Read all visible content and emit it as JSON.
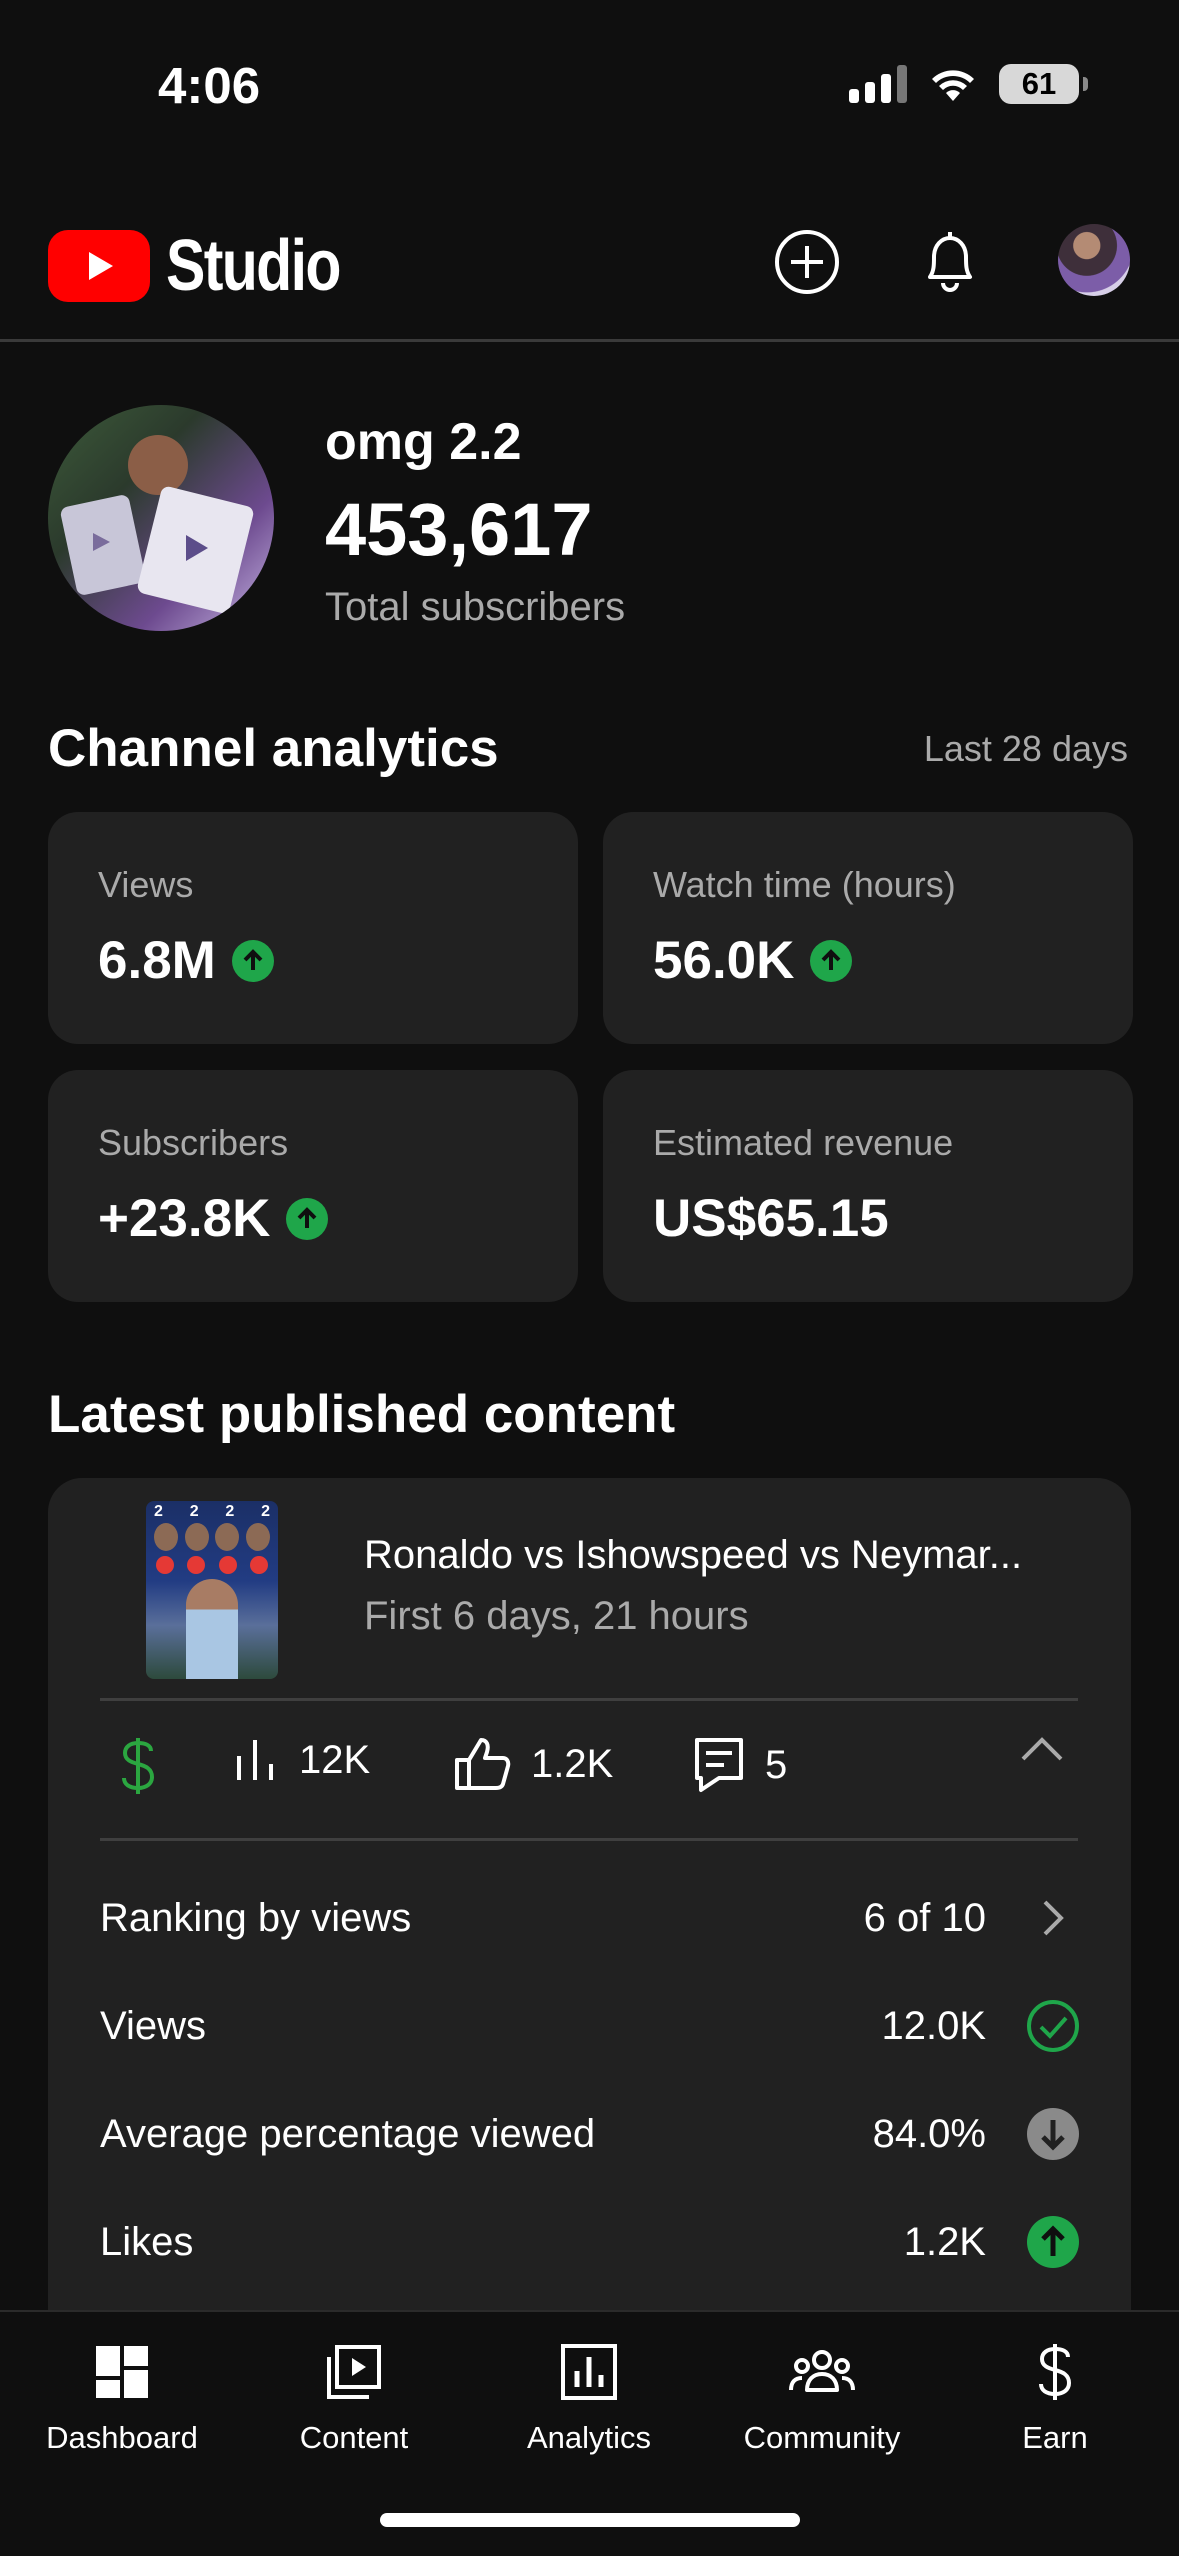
{
  "status_bar": {
    "time": "4:06",
    "battery": "61"
  },
  "header": {
    "app_name": "Studio"
  },
  "channel": {
    "name": "omg 2.2",
    "subscribers": "453,617",
    "subscribers_label": "Total subscribers"
  },
  "analytics": {
    "title": "Channel analytics",
    "period": "Last 28 days",
    "cards": [
      {
        "label": "Views",
        "value": "6.8M",
        "trend": "up"
      },
      {
        "label": "Watch time (hours)",
        "value": "56.0K",
        "trend": "up"
      },
      {
        "label": "Subscribers",
        "value": "+23.8K",
        "trend": "up"
      },
      {
        "label": "Estimated revenue",
        "value": "US$65.15"
      }
    ]
  },
  "latest": {
    "title": "Latest published content",
    "video": {
      "title": "Ronaldo vs Ishowspeed vs Neymar...",
      "age": "First 6 days, 21 hours",
      "thumbnail_numbers": [
        "2",
        "2",
        "2",
        "2"
      ]
    },
    "stats": {
      "views": "12K",
      "likes": "1.2K",
      "comments": "5"
    },
    "metrics": [
      {
        "label": "Ranking by views",
        "value": "6 of 10",
        "icon": "chevron-right-icon"
      },
      {
        "label": "Views",
        "value": "12.0K",
        "icon": "check-circle-icon"
      },
      {
        "label": "Average percentage viewed",
        "value": "84.0%",
        "icon": "arrow-down-circle-icon"
      },
      {
        "label": "Likes",
        "value": "1.2K",
        "icon": "arrow-up-circle-icon"
      }
    ]
  },
  "nav": {
    "items": [
      {
        "label": "Dashboard"
      },
      {
        "label": "Content"
      },
      {
        "label": "Analytics"
      },
      {
        "label": "Community"
      },
      {
        "label": "Earn"
      }
    ]
  },
  "colors": {
    "accent_red": "#ff0000",
    "trend_green": "#1fa64a",
    "card_bg": "#212121",
    "bg": "#0f0f0f"
  }
}
